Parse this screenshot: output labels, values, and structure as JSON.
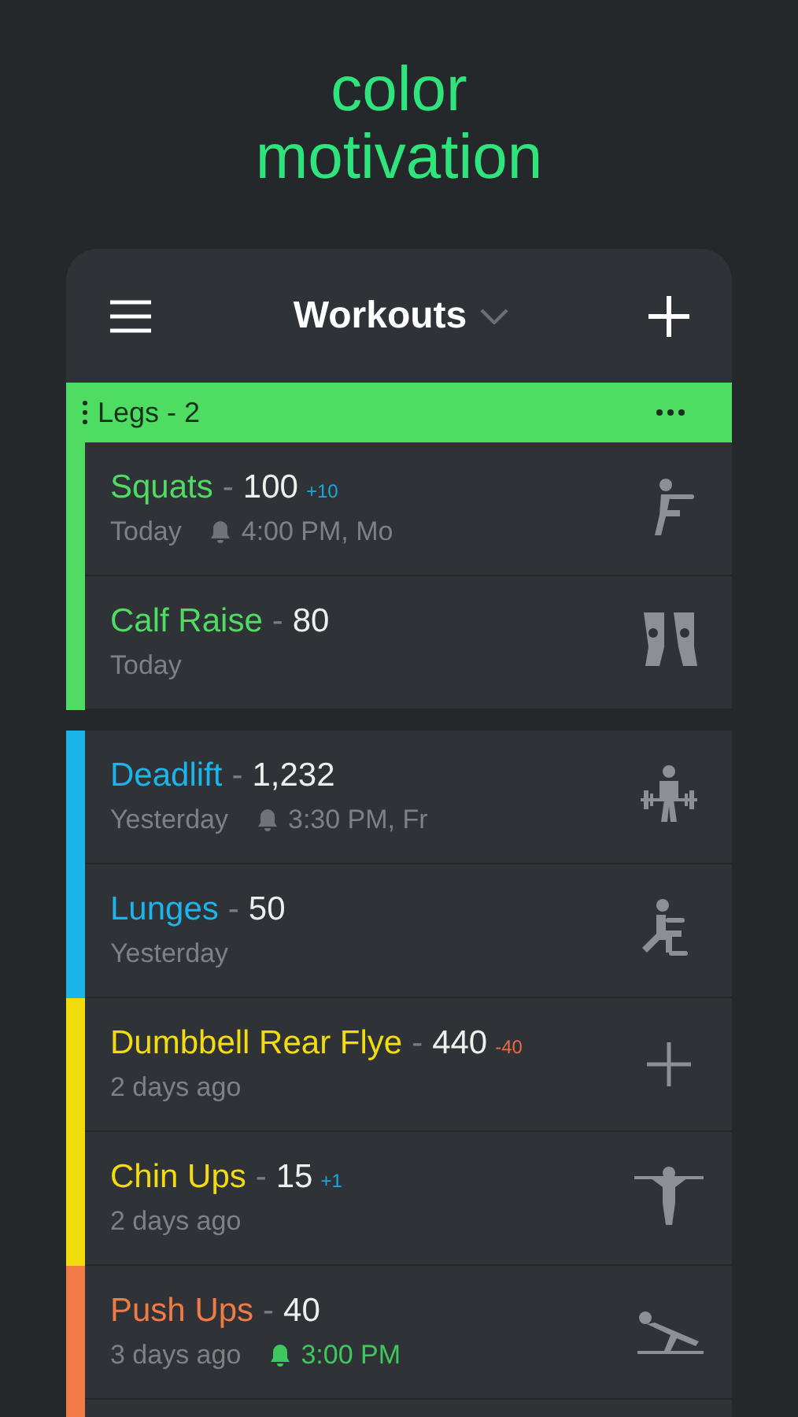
{
  "headline": [
    "color",
    "motivation"
  ],
  "header": {
    "title": "Workouts"
  },
  "groups": [
    {
      "name": "Legs - 2",
      "color": "#4fdc62",
      "exercises": [
        {
          "kind": "squat",
          "name": "Squats",
          "separator": "-",
          "value": "100",
          "delta": {
            "text": "+10",
            "kind": "increase"
          },
          "when": "Today",
          "reminder": {
            "text": "4:00 PM, Mo",
            "active": false
          }
        },
        {
          "kind": "calf",
          "name": "Calf Raise",
          "separator": "-",
          "value": "80",
          "when": "Today"
        }
      ]
    },
    {
      "exercises": [
        {
          "kind": "deadlift",
          "name": "Deadlift",
          "separator": "-",
          "value": "1,232",
          "color": "#1cb5ea",
          "when": "Yesterday",
          "reminder": {
            "text": "3:30 PM, Fr",
            "active": false
          }
        },
        {
          "kind": "lunge",
          "name": "Lunges",
          "separator": "-",
          "value": "50",
          "color": "#1cb5ea",
          "when": "Yesterday"
        },
        {
          "kind": "add",
          "name": "Dumbbell Rear Flye",
          "separator": "-",
          "value": "440",
          "color": "#f2dc0e",
          "delta": {
            "text": "-40",
            "kind": "decrease"
          },
          "when": "2 days ago"
        },
        {
          "kind": "chinup",
          "name": "Chin Ups",
          "separator": "-",
          "value": "15",
          "color": "#f2dc0e",
          "delta": {
            "text": "+1",
            "kind": "increase"
          },
          "when": "2 days ago"
        },
        {
          "kind": "pushup",
          "name": "Push Ups",
          "separator": "-",
          "value": "40",
          "color": "#f07b46",
          "when": "3 days ago",
          "reminder": {
            "text": "3:00 PM",
            "active": true
          }
        },
        {
          "kind": "partial",
          "color": "#f07b46"
        }
      ]
    }
  ]
}
